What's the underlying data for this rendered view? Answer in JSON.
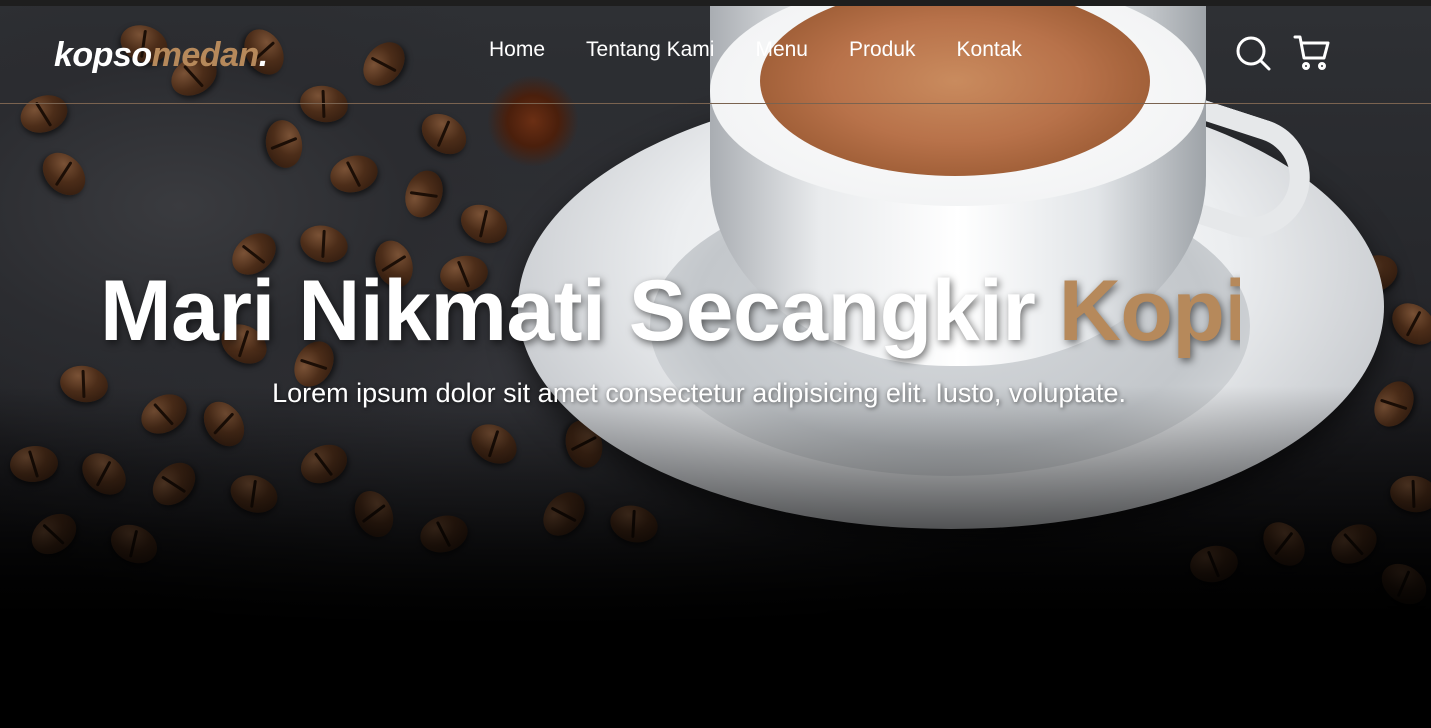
{
  "brand": {
    "name_main": "kopso",
    "name_accent": "medan",
    "name_dot": "."
  },
  "nav": {
    "links": [
      {
        "label": "Home"
      },
      {
        "label": "Tentang Kami"
      },
      {
        "label": "Menu"
      },
      {
        "label": "Produk"
      },
      {
        "label": "Kontak"
      }
    ],
    "icons": [
      "search-icon",
      "shopping-cart-icon"
    ]
  },
  "hero": {
    "title_main": "Mari Nikmati Secangkir ",
    "title_accent": "Kopi",
    "subtitle": "Lorem ipsum dolor sit amet consectetur adipisicing elit. Iusto, voluptate."
  },
  "colors": {
    "accent": "#b6895b",
    "text": "#ffffff",
    "navbar_border": "#7a6350"
  }
}
